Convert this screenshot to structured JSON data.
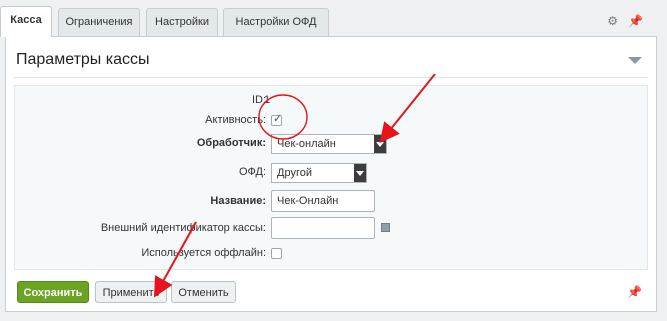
{
  "tabs": [
    {
      "label": "Касса",
      "active": true
    },
    {
      "label": "Ограничения"
    },
    {
      "label": "Настройки"
    },
    {
      "label": "Настройки ОФД"
    }
  ],
  "tab_icons": [
    "gear-icon",
    "pin-icon"
  ],
  "panel": {
    "title": "Параметры кассы"
  },
  "form": {
    "id": {
      "label": "ID:",
      "value": "1"
    },
    "active": {
      "label": "Активность:",
      "checked": true
    },
    "handler": {
      "label": "Обработчик:",
      "value": "Чек-онлайн"
    },
    "ofd": {
      "label": "ОФД:",
      "value": "Другой"
    },
    "name": {
      "label": "Название:",
      "value": "Чек-Онлайн"
    },
    "external_id": {
      "label": "Внешний идентификатор кассы:",
      "value": ""
    },
    "offline": {
      "label": "Используется оффлайн:",
      "checked": false
    }
  },
  "buttons": {
    "save": "Сохранить",
    "apply": "Применить",
    "cancel": "Отменить"
  },
  "annotation_color": "#e8141c"
}
